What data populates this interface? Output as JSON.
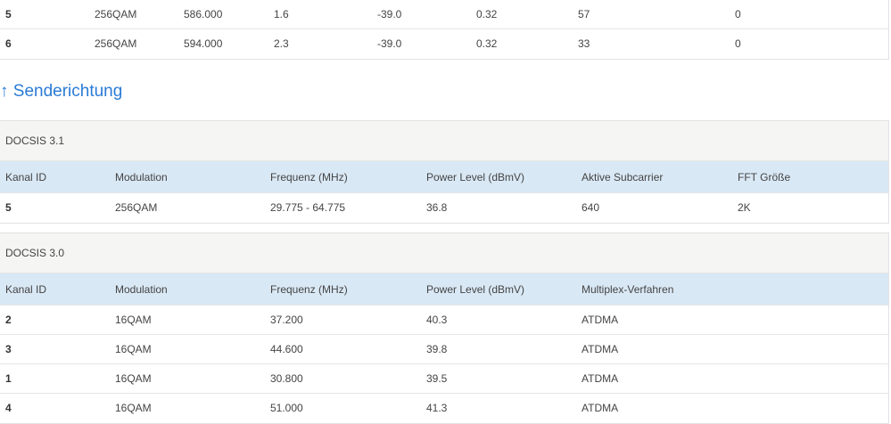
{
  "downstream_rows": [
    [
      "5",
      "256QAM",
      "586.000",
      "1.6",
      "-39.0",
      "0.32",
      "57",
      "0"
    ],
    [
      "6",
      "256QAM",
      "594.000",
      "2.3",
      "-39.0",
      "0.32",
      "33",
      "0"
    ]
  ],
  "upstream": {
    "heading": "↑ Senderichtung",
    "docsis31": {
      "title": "DOCSIS 3.1",
      "headers": [
        "Kanal ID",
        "Modulation",
        "Frequenz (MHz)",
        "Power Level (dBmV)",
        "Aktive Subcarrier",
        "FFT Größe"
      ],
      "rows": [
        [
          "5",
          "256QAM",
          "29.775 - 64.775",
          "36.8",
          "640",
          "2K"
        ]
      ]
    },
    "docsis30": {
      "title": "DOCSIS 3.0",
      "headers": [
        "Kanal ID",
        "Modulation",
        "Frequenz (MHz)",
        "Power Level (dBmV)",
        "Multiplex-Verfahren"
      ],
      "rows": [
        [
          "2",
          "16QAM",
          "37.200",
          "40.3",
          "ATDMA"
        ],
        [
          "3",
          "16QAM",
          "44.600",
          "39.8",
          "ATDMA"
        ],
        [
          "1",
          "16QAM",
          "30.800",
          "39.5",
          "ATDMA"
        ],
        [
          "4",
          "16QAM",
          "51.000",
          "41.3",
          "ATDMA"
        ]
      ]
    }
  }
}
